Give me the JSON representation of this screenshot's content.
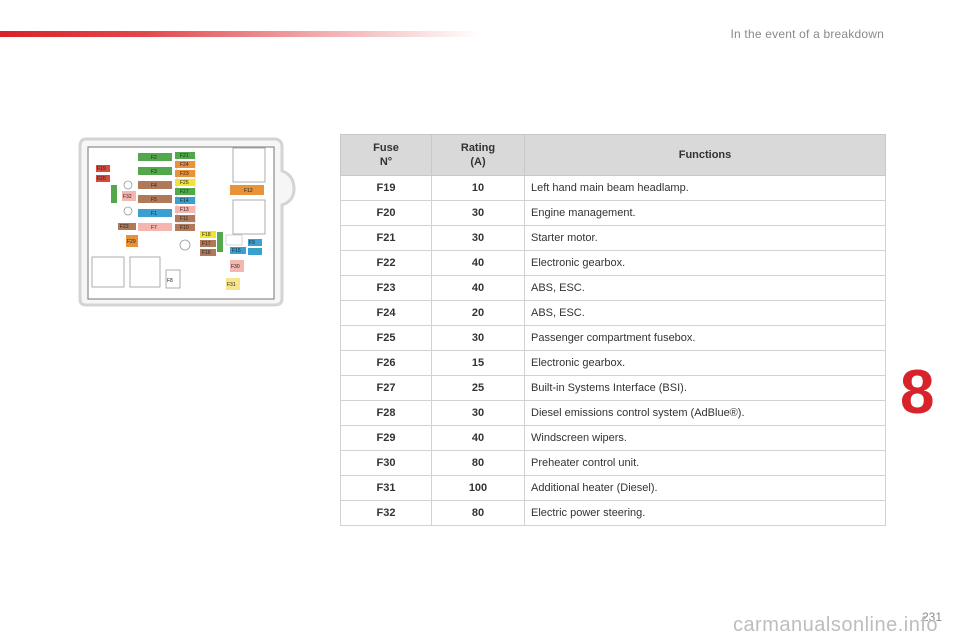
{
  "header": {
    "section_title": "In the event of a breakdown"
  },
  "chapter": {
    "number": "8",
    "color": "#d8232a"
  },
  "footer": {
    "page_number": "231",
    "watermark": "carmanualsonline.info"
  },
  "diagram": {
    "fuse_labels": [
      "F2",
      "F3",
      "F4",
      "F5",
      "F1",
      "F7",
      "F12",
      "F21",
      "F24",
      "F23",
      "F25",
      "F27",
      "F14",
      "F13",
      "F11",
      "F10",
      "F19",
      "F20",
      "F22",
      "F32",
      "F29",
      "F18",
      "F17",
      "F16",
      "F15",
      "F9",
      "F30",
      "F31",
      "F8",
      "F6"
    ]
  },
  "table": {
    "headers": {
      "fuse": [
        "Fuse",
        "N°"
      ],
      "rating": [
        "Rating",
        "(A)"
      ],
      "functions": "Functions"
    },
    "rows": [
      {
        "fuse": "F19",
        "rating": "10",
        "function": "Left hand main beam headlamp."
      },
      {
        "fuse": "F20",
        "rating": "30",
        "function": "Engine management."
      },
      {
        "fuse": "F21",
        "rating": "30",
        "function": "Starter motor."
      },
      {
        "fuse": "F22",
        "rating": "40",
        "function": "Electronic gearbox."
      },
      {
        "fuse": "F23",
        "rating": "40",
        "function": "ABS, ESC."
      },
      {
        "fuse": "F24",
        "rating": "20",
        "function": "ABS, ESC."
      },
      {
        "fuse": "F25",
        "rating": "30",
        "function": "Passenger compartment fusebox."
      },
      {
        "fuse": "F26",
        "rating": "15",
        "function": "Electronic gearbox."
      },
      {
        "fuse": "F27",
        "rating": "25",
        "function": "Built-in Systems Interface (BSI)."
      },
      {
        "fuse": "F28",
        "rating": "30",
        "function": "Diesel emissions control system (AdBlue®)."
      },
      {
        "fuse": "F29",
        "rating": "40",
        "function": "Windscreen wipers."
      },
      {
        "fuse": "F30",
        "rating": "80",
        "function": "Preheater control unit."
      },
      {
        "fuse": "F31",
        "rating": "100",
        "function": "Additional heater (Diesel)."
      },
      {
        "fuse": "F32",
        "rating": "80",
        "function": "Electric power steering."
      }
    ]
  }
}
